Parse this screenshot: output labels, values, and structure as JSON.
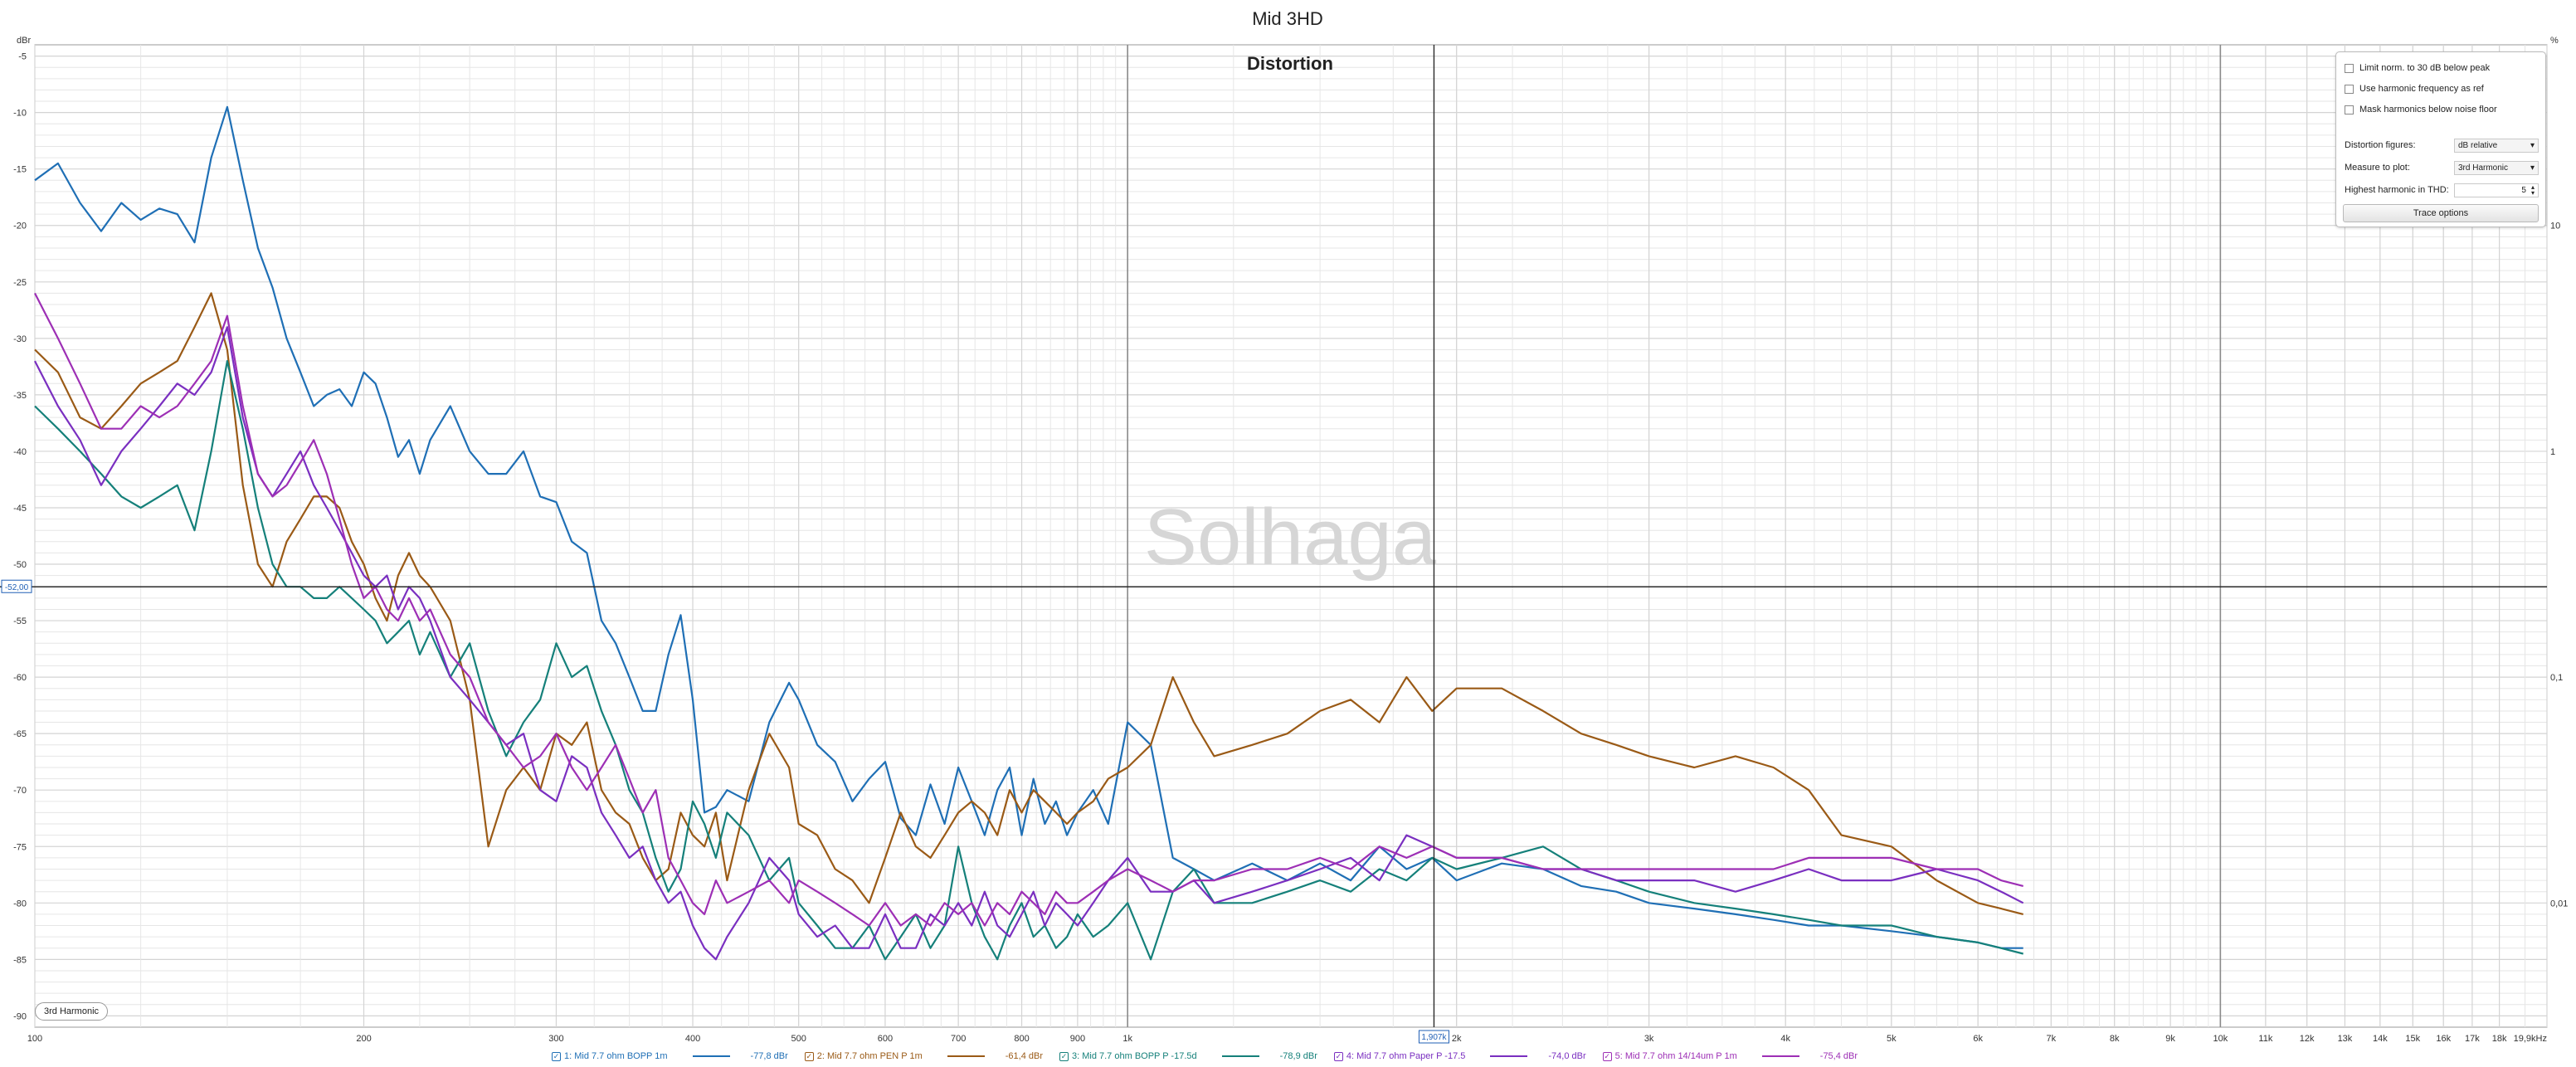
{
  "window": {
    "title": "Mid 3HD"
  },
  "chart_data": {
    "type": "line",
    "title": "Distortion",
    "watermark": "Solhaga",
    "y_unit_label": "dBr",
    "y2_unit_label": "%",
    "xscale": "log",
    "xlim": [
      100,
      19900
    ],
    "ylim": [
      -91,
      -4
    ],
    "grid": true,
    "legend_position": "bottom",
    "y_ticks": [
      "-5",
      "-10",
      "-15",
      "-20",
      "-25",
      "-30",
      "-35",
      "-40",
      "-45",
      "-50",
      "-55",
      "-60",
      "-65",
      "-70",
      "-75",
      "-80",
      "-85",
      "-90"
    ],
    "y2_ticks": [
      "10",
      "1",
      "0,1",
      "0,01"
    ],
    "x_ticks": [
      "100",
      "200",
      "300",
      "400",
      "500",
      "600",
      "700",
      "800",
      "900",
      "1k",
      "2k",
      "3k",
      "4k",
      "5k",
      "6k",
      "7k",
      "8k",
      "9k",
      "10k",
      "11k",
      "12k",
      "13k",
      "14k",
      "15k",
      "16k",
      "17k",
      "18k",
      "19,9kHz"
    ],
    "cursor": {
      "x_label": "1,907k",
      "y_label": "-52,00",
      "x": 1907,
      "y": -52
    },
    "series": [
      {
        "name": "1: Mid 7.7 ohm BOPP 1m",
        "value_label": "-77,8 dBr",
        "color": "#1f6fb5",
        "x": [
          100,
          105,
          110,
          115,
          120,
          125,
          130,
          135,
          140,
          145,
          150,
          155,
          160,
          165,
          170,
          175,
          180,
          185,
          190,
          195,
          200,
          205,
          210,
          215,
          220,
          225,
          230,
          240,
          250,
          260,
          270,
          280,
          290,
          300,
          310,
          320,
          330,
          340,
          350,
          360,
          370,
          380,
          390,
          400,
          410,
          420,
          430,
          450,
          470,
          490,
          500,
          520,
          540,
          560,
          580,
          600,
          620,
          640,
          660,
          680,
          700,
          720,
          740,
          760,
          780,
          800,
          820,
          840,
          860,
          880,
          900,
          930,
          960,
          1000,
          1050,
          1100,
          1150,
          1200,
          1300,
          1400,
          1500,
          1600,
          1700,
          1800,
          1900,
          2000,
          2200,
          2400,
          2600,
          2800,
          3000,
          3300,
          3600,
          3900,
          4200,
          4500,
          5000,
          5500,
          6000,
          6300,
          6600
        ],
        "y": [
          -16,
          -14.5,
          -18,
          -20.5,
          -18,
          -19.5,
          -18.5,
          -19,
          -21.5,
          -14,
          -9.5,
          -16,
          -22,
          -25.5,
          -30,
          -33,
          -36,
          -35,
          -34.5,
          -36,
          -33,
          -34,
          -37,
          -40.5,
          -39,
          -42,
          -39,
          -36,
          -40,
          -42,
          -42,
          -40,
          -44,
          -44.5,
          -48,
          -49,
          -55,
          -57,
          -60,
          -63,
          -63,
          -58,
          -54.5,
          -62,
          -72,
          -71.5,
          -70,
          -71,
          -64,
          -60.5,
          -62,
          -66,
          -67.5,
          -71,
          -69,
          -67.5,
          -72.5,
          -74,
          -69.5,
          -73,
          -68,
          -71,
          -74,
          -70,
          -68,
          -74,
          -69,
          -73,
          -71,
          -74,
          -72,
          -70,
          -73,
          -64,
          -66,
          -76,
          -77,
          -78,
          -76.5,
          -78,
          -76.5,
          -78,
          -75,
          -77,
          -76,
          -78,
          -76.5,
          -77,
          -78.5,
          -79,
          -80,
          -80.5,
          -81,
          -81.5,
          -82,
          -82,
          -82.5,
          -83,
          -83.5,
          -84,
          -84
        ]
      },
      {
        "name": "2: Mid 7.7 ohm PEN P 1m",
        "value_label": "-61,4 dBr",
        "color": "#9a5a16",
        "x": [
          100,
          105,
          110,
          115,
          120,
          125,
          130,
          135,
          140,
          145,
          150,
          155,
          160,
          165,
          170,
          175,
          180,
          185,
          190,
          195,
          200,
          205,
          210,
          215,
          220,
          225,
          230,
          240,
          250,
          260,
          270,
          280,
          290,
          300,
          310,
          320,
          330,
          340,
          350,
          360,
          370,
          380,
          390,
          400,
          410,
          420,
          430,
          450,
          470,
          490,
          500,
          520,
          540,
          560,
          580,
          600,
          620,
          640,
          660,
          680,
          700,
          720,
          740,
          760,
          780,
          800,
          820,
          840,
          860,
          880,
          900,
          930,
          960,
          1000,
          1050,
          1100,
          1150,
          1200,
          1300,
          1400,
          1500,
          1600,
          1700,
          1800,
          1900,
          2000,
          2200,
          2400,
          2600,
          2800,
          3000,
          3300,
          3600,
          3900,
          4200,
          4500,
          5000,
          5500,
          6000,
          6300,
          6600
        ],
        "y": [
          -31,
          -33,
          -37,
          -38,
          -36,
          -34,
          -33,
          -32,
          -29,
          -26,
          -31,
          -43,
          -50,
          -52,
          -48,
          -46,
          -44,
          -44,
          -45,
          -48,
          -50,
          -53,
          -55,
          -51,
          -49,
          -51,
          -52,
          -55,
          -62,
          -75,
          -70,
          -68,
          -70,
          -65,
          -66,
          -64,
          -70,
          -72,
          -73,
          -76,
          -78,
          -77,
          -72,
          -74,
          -75,
          -72,
          -78,
          -70,
          -65,
          -68,
          -73,
          -74,
          -77,
          -78,
          -80,
          -76,
          -72,
          -75,
          -76,
          -74,
          -72,
          -71,
          -72,
          -74,
          -70,
          -72,
          -70,
          -71,
          -72,
          -73,
          -72,
          -71,
          -69,
          -68,
          -66,
          -60,
          -64,
          -67,
          -66,
          -65,
          -63,
          -62,
          -64,
          -60,
          -63,
          -61,
          -61,
          -63,
          -65,
          -66,
          -67,
          -68,
          -67,
          -68,
          -70,
          -74,
          -75,
          -78,
          -80,
          -80.5,
          -81
        ]
      },
      {
        "name": "3: Mid 7.7 ohm BOPP P -17.5d",
        "value_label": "-78,9 dBr",
        "color": "#15807a",
        "x": [
          100,
          105,
          110,
          115,
          120,
          125,
          130,
          135,
          140,
          145,
          150,
          155,
          160,
          165,
          170,
          175,
          180,
          185,
          190,
          195,
          200,
          205,
          210,
          215,
          220,
          225,
          230,
          240,
          250,
          260,
          270,
          280,
          290,
          300,
          310,
          320,
          330,
          340,
          350,
          360,
          370,
          380,
          390,
          400,
          410,
          420,
          430,
          450,
          470,
          490,
          500,
          520,
          540,
          560,
          580,
          600,
          620,
          640,
          660,
          680,
          700,
          720,
          740,
          760,
          780,
          800,
          820,
          840,
          860,
          880,
          900,
          930,
          960,
          1000,
          1050,
          1100,
          1150,
          1200,
          1300,
          1400,
          1500,
          1600,
          1700,
          1800,
          1900,
          2000,
          2200,
          2400,
          2600,
          2800,
          3000,
          3300,
          3600,
          3900,
          4200,
          4500,
          5000,
          5500,
          6000,
          6300,
          6600
        ],
        "y": [
          -36,
          -38,
          -40,
          -42,
          -44,
          -45,
          -44,
          -43,
          -47,
          -40,
          -32,
          -38,
          -45,
          -50,
          -52,
          -52,
          -53,
          -53,
          -52,
          -53,
          -54,
          -55,
          -57,
          -56,
          -55,
          -58,
          -56,
          -60,
          -57,
          -63,
          -67,
          -64,
          -62,
          -57,
          -60,
          -59,
          -63,
          -66,
          -70,
          -72,
          -76,
          -79,
          -77,
          -71,
          -73,
          -76,
          -72,
          -74,
          -78,
          -76,
          -80,
          -82,
          -84,
          -84,
          -82,
          -85,
          -83,
          -81,
          -84,
          -82,
          -75,
          -80,
          -83,
          -85,
          -82,
          -80,
          -83,
          -82,
          -84,
          -83,
          -81,
          -83,
          -82,
          -80,
          -85,
          -79,
          -77,
          -80,
          -80,
          -79,
          -78,
          -79,
          -77,
          -78,
          -76,
          -77,
          -76,
          -75,
          -77,
          -78,
          -79,
          -80,
          -80.5,
          -81,
          -81.5,
          -82,
          -82,
          -83,
          -83.5,
          -84,
          -84.5
        ]
      },
      {
        "name": "4: Mid 7.7 ohm Paper P -17.5",
        "value_label": "-74,0 dBr",
        "color": "#7a2fc0",
        "x": [
          100,
          105,
          110,
          115,
          120,
          125,
          130,
          135,
          140,
          145,
          150,
          155,
          160,
          165,
          170,
          175,
          180,
          185,
          190,
          195,
          200,
          205,
          210,
          215,
          220,
          225,
          230,
          240,
          250,
          260,
          270,
          280,
          290,
          300,
          310,
          320,
          330,
          340,
          350,
          360,
          370,
          380,
          390,
          400,
          410,
          420,
          430,
          450,
          470,
          490,
          500,
          520,
          540,
          560,
          580,
          600,
          620,
          640,
          660,
          680,
          700,
          720,
          740,
          760,
          780,
          800,
          820,
          840,
          860,
          880,
          900,
          930,
          960,
          1000,
          1050,
          1100,
          1150,
          1200,
          1300,
          1400,
          1500,
          1600,
          1700,
          1800,
          1900,
          2000,
          2200,
          2400,
          2600,
          2800,
          3000,
          3300,
          3600,
          3900,
          4200,
          4500,
          5000,
          5500,
          6000,
          6300,
          6600
        ],
        "y": [
          -32,
          -36,
          -39,
          -43,
          -40,
          -38,
          -36,
          -34,
          -35,
          -33,
          -29,
          -37,
          -42,
          -44,
          -42,
          -40,
          -43,
          -45,
          -47,
          -49,
          -51,
          -52,
          -51,
          -54,
          -52,
          -53,
          -55,
          -60,
          -62,
          -64,
          -66,
          -65,
          -70,
          -71,
          -67,
          -68,
          -72,
          -74,
          -76,
          -75,
          -78,
          -80,
          -79,
          -82,
          -84,
          -85,
          -83,
          -80,
          -76,
          -78,
          -81,
          -83,
          -82,
          -84,
          -84,
          -81,
          -84,
          -84,
          -81,
          -82,
          -80,
          -82,
          -79,
          -82,
          -83,
          -81,
          -79,
          -82,
          -80,
          -81,
          -82,
          -80,
          -78,
          -76,
          -79,
          -79,
          -78,
          -80,
          -79,
          -78,
          -77,
          -76,
          -78,
          -74,
          -75,
          -76,
          -76,
          -77,
          -77,
          -78,
          -78,
          -78,
          -79,
          -78,
          -77,
          -78,
          -78,
          -77,
          -78,
          -79,
          -80
        ]
      },
      {
        "name": "5: Mid 7.7 ohm 14/14um P 1m",
        "value_label": "-75,4 dBr",
        "color": "#9d2fb5",
        "x": [
          100,
          105,
          110,
          115,
          120,
          125,
          130,
          135,
          140,
          145,
          150,
          155,
          160,
          165,
          170,
          175,
          180,
          185,
          190,
          195,
          200,
          205,
          210,
          215,
          220,
          225,
          230,
          240,
          250,
          260,
          270,
          280,
          290,
          300,
          310,
          320,
          330,
          340,
          350,
          360,
          370,
          380,
          390,
          400,
          410,
          420,
          430,
          450,
          470,
          490,
          500,
          520,
          540,
          560,
          580,
          600,
          620,
          640,
          660,
          680,
          700,
          720,
          740,
          760,
          780,
          800,
          820,
          840,
          860,
          880,
          900,
          930,
          960,
          1000,
          1050,
          1100,
          1150,
          1200,
          1300,
          1400,
          1500,
          1600,
          1700,
          1800,
          1900,
          2000,
          2200,
          2400,
          2600,
          2800,
          3000,
          3300,
          3600,
          3900,
          4200,
          4500,
          5000,
          5500,
          6000,
          6300,
          6600
        ],
        "y": [
          -26,
          -30,
          -34,
          -38,
          -38,
          -36,
          -37,
          -36,
          -34,
          -32,
          -28,
          -36,
          -42,
          -44,
          -43,
          -41,
          -39,
          -42,
          -46,
          -50,
          -53,
          -52,
          -54,
          -55,
          -53,
          -55,
          -54,
          -58,
          -60,
          -64,
          -66,
          -68,
          -67,
          -65,
          -68,
          -70,
          -68,
          -66,
          -69,
          -72,
          -70,
          -76,
          -78,
          -80,
          -81,
          -78,
          -80,
          -79,
          -78,
          -80,
          -78,
          -79,
          -80,
          -81,
          -82,
          -80,
          -82,
          -81,
          -82,
          -80,
          -81,
          -80,
          -82,
          -80,
          -81,
          -79,
          -80,
          -81,
          -79,
          -80,
          -80,
          -79,
          -78,
          -77,
          -78,
          -79,
          -78,
          -78,
          -77,
          -77,
          -76,
          -77,
          -75,
          -76,
          -75,
          -76,
          -76,
          -77,
          -77,
          -77,
          -77,
          -77,
          -77,
          -77,
          -76,
          -76,
          -76,
          -77,
          -77,
          -78,
          -78.5
        ]
      }
    ]
  },
  "panel": {
    "checkboxes": [
      {
        "label": "Limit norm. to 30 dB below peak",
        "checked": false
      },
      {
        "label": "Use harmonic frequency as ref",
        "checked": false
      },
      {
        "label": "Mask harmonics below noise floor",
        "checked": false
      }
    ],
    "distortion_figures": {
      "label": "Distortion figures:",
      "value": "dB relative"
    },
    "measure_to_plot": {
      "label": "Measure to plot:",
      "value": "3rd Harmonic"
    },
    "highest_harmonic": {
      "label": "Highest harmonic in THD:",
      "value": "5"
    },
    "trace_options_label": "Trace options"
  },
  "harmonic_badge": "3rd Harmonic"
}
